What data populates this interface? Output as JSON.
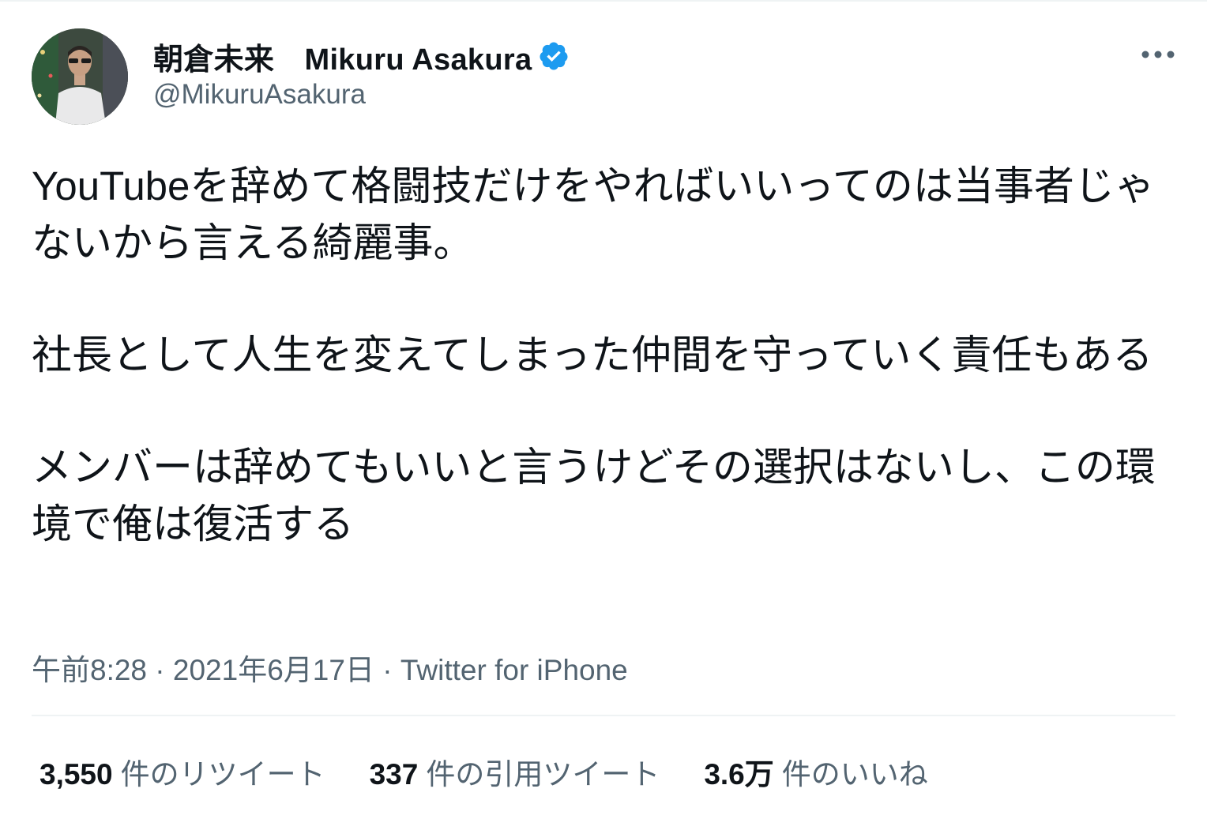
{
  "user": {
    "display_name": "朝倉未来　Mikuru Asakura",
    "handle": "@MikuruAsakura",
    "verified": true
  },
  "tweet": {
    "paragraphs": [
      "YouTubeを辞めて格闘技だけをやればいいってのは当事者じゃないから言える綺麗事。",
      "社長として人生を変えてしまった仲間を守っていく責任もある",
      "メンバーは辞めてもいいと言うけどその選択はないし、この環境で俺は復活する"
    ],
    "time": "午前8:28",
    "date": "2021年6月17日",
    "source": "Twitter for iPhone",
    "separator": " · "
  },
  "stats": {
    "retweets": {
      "count": "3,550",
      "label": "件のリツイート"
    },
    "quotes": {
      "count": "337",
      "label": "件の引用ツイート"
    },
    "likes": {
      "count": "3.6万",
      "label": "件のいいね"
    }
  },
  "icons": {
    "verified": "verified-badge-icon",
    "more": "more-options-icon"
  },
  "colors": {
    "verified": "#1d9bf0",
    "secondary_text": "#536471",
    "primary_text": "#0f1419"
  }
}
